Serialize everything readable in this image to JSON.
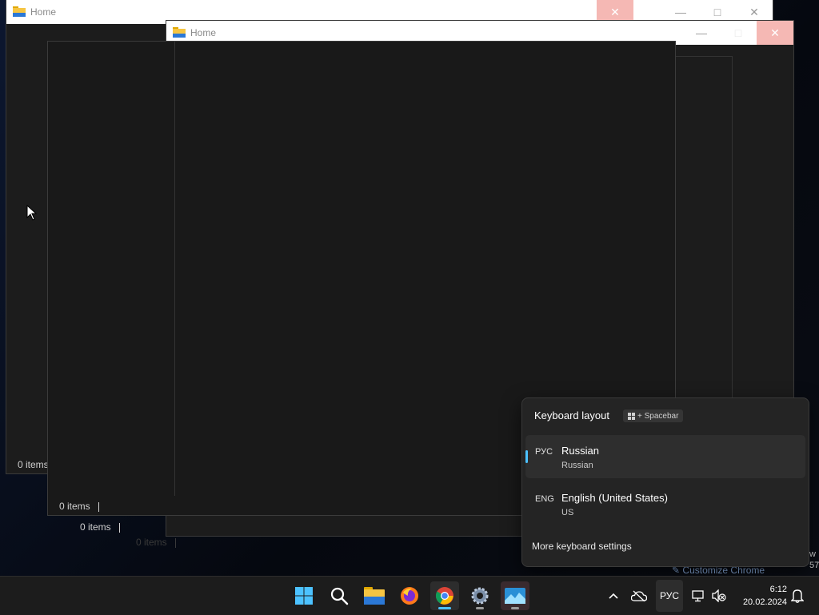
{
  "windows": {
    "back": {
      "title": "Home",
      "status": "0 items"
    },
    "middle": {
      "title": "Home",
      "status": "0 items"
    },
    "front": {
      "status": "0 items"
    },
    "ghost": {
      "status": "0 items"
    }
  },
  "keyboard_flyout": {
    "title": "Keyboard layout",
    "shortcut": "+ Spacebar",
    "layouts": [
      {
        "code": "РУС",
        "name": "Russian",
        "sub": "Russian",
        "selected": true
      },
      {
        "code": "ENG",
        "name": "English (United States)",
        "sub": "US",
        "selected": false
      }
    ],
    "more_label": "More keyboard settings"
  },
  "background_hint": {
    "customize_chrome": "Customize Chrome",
    "edge_w": "w",
    "edge_num": "57"
  },
  "taskbar": {
    "apps": [
      "start-icon",
      "search-icon",
      "file-explorer-icon",
      "firefox-icon",
      "chrome-icon",
      "settings-icon",
      "photos-icon"
    ],
    "tray": {
      "language": "РУС",
      "time": "6:12",
      "date": "20.02.2024"
    }
  },
  "colors": {
    "accent": "#4cc2ff",
    "taskbar": "#1c1c1c",
    "flyout": "#242424"
  }
}
